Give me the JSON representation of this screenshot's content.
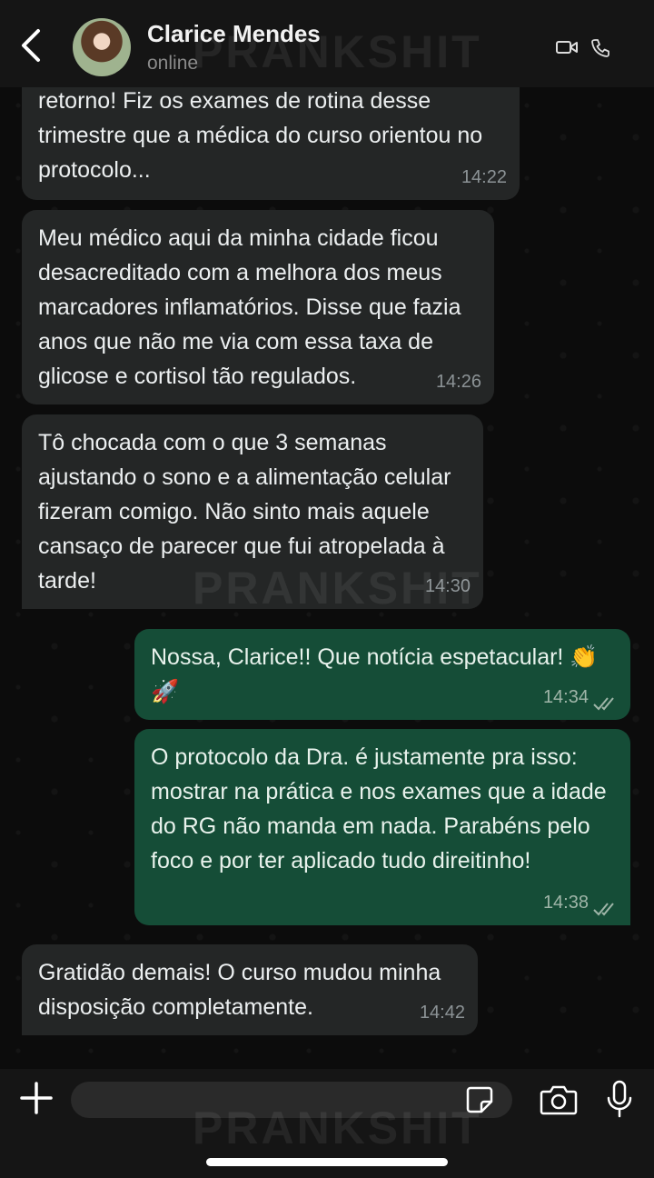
{
  "header": {
    "contact_name": "Clarice Mendes",
    "status": "online",
    "icons": [
      "back-icon",
      "video-icon",
      "phone-icon"
    ]
  },
  "watermark": "PRANKSHIT",
  "messages": [
    {
      "direction": "in",
      "text": "retorno! Fiz os exames de rotina desse trimestre que a médica do curso orientou no protocolo...",
      "time": "14:22"
    },
    {
      "direction": "in",
      "text": "Meu médico aqui da minha cidade ficou desacreditado com a melhora dos meus marcadores inflamatórios. Disse que fazia anos que não me via com essa taxa de glicose e cortisol tão regulados.",
      "time": "14:26"
    },
    {
      "direction": "in",
      "text": "Tô chocada com o que 3 semanas ajustando o sono e a alimentação celular fizeram comigo. Não sinto mais aquele cansaço de parecer que fui atropelada à tarde!",
      "time": "14:30"
    },
    {
      "direction": "out",
      "text": "Nossa, Clarice!! Que notícia espetacular! 👏 🚀",
      "time": "14:34",
      "status": "read"
    },
    {
      "direction": "out",
      "text": "O protocolo da Dra. é justamente pra isso: mostrar na prática e nos exames que a idade do RG não manda em nada. Parabéns pelo foco e por ter aplicado tudo direitinho!",
      "time": "14:38",
      "status": "read"
    },
    {
      "direction": "in",
      "text": "Gratidão demais! O curso mudou minha disposição completamente.",
      "time": "14:42"
    }
  ],
  "composer": {
    "placeholder": "",
    "icons": [
      "plus-icon",
      "sticker-icon",
      "camera-icon",
      "microphone-icon"
    ]
  },
  "colors": {
    "incoming_bubble": "#242626",
    "outgoing_bubble": "#154d37",
    "header_bg": "#151515"
  }
}
